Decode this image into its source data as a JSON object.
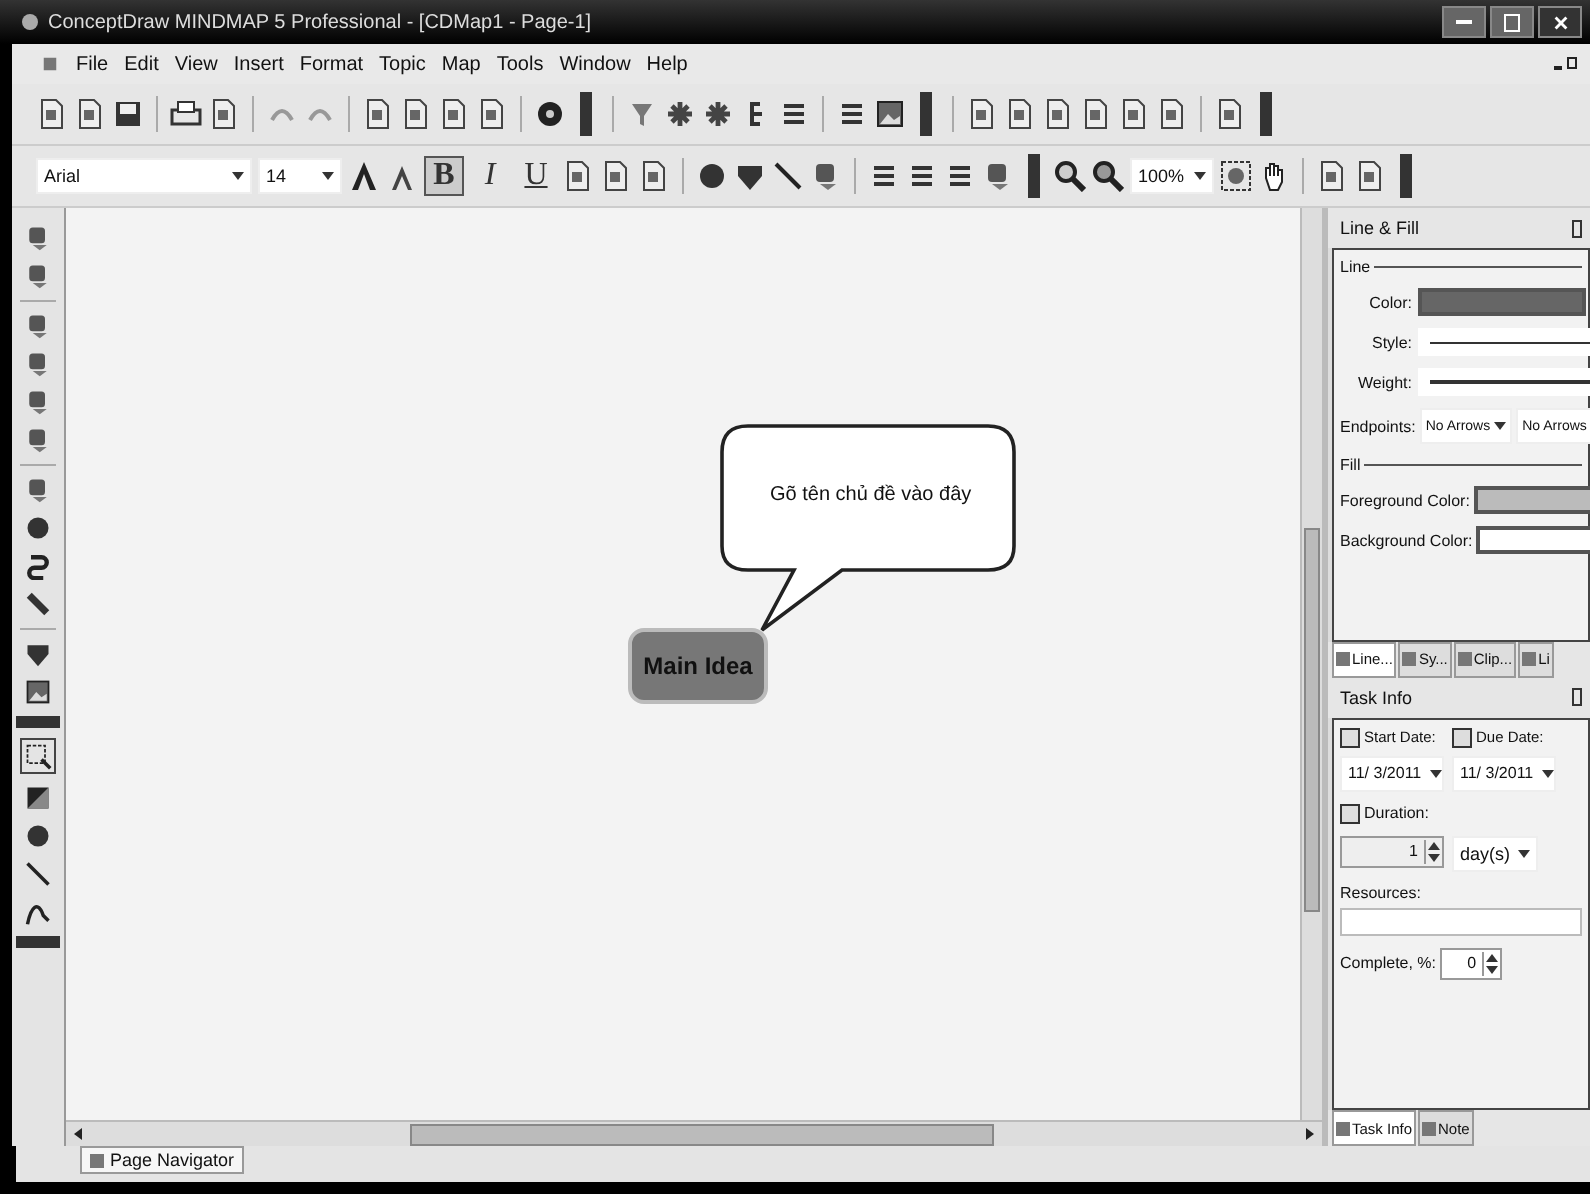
{
  "window": {
    "title": "ConceptDraw MINDMAP 5 Professional - [CDMap1 - Page-1]"
  },
  "menu": [
    "File",
    "Edit",
    "View",
    "Insert",
    "Format",
    "Topic",
    "Map",
    "Tools",
    "Window",
    "Help"
  ],
  "format_toolbar": {
    "font": "Arial",
    "size": "14",
    "zoom": "100%",
    "styles": [
      {
        "label": "B",
        "kind": "bold",
        "selected": true
      },
      {
        "label": "I",
        "kind": "italic",
        "selected": false
      },
      {
        "label": "U",
        "kind": "underline",
        "selected": false
      }
    ]
  },
  "canvas": {
    "callout": "Gõ tên chủ đề vào đây",
    "main_topic": "Main Idea"
  },
  "line_fill_panel": {
    "title": "Line & Fill",
    "line_section": "Line",
    "color_label": "Color:",
    "style_label": "Style:",
    "weight_label": "Weight:",
    "endpoints_label": "Endpoints:",
    "endpoint_start": "No Arrows",
    "endpoint_end": "No Arrows",
    "fill_section": "Fill",
    "foreground_label": "Foreground Color:",
    "background_label": "Background Color:",
    "tabs": [
      {
        "label": "Line...",
        "selected": true
      },
      {
        "label": "Sy...",
        "selected": false
      },
      {
        "label": "Clip...",
        "selected": false
      },
      {
        "label": "Li",
        "selected": false
      }
    ]
  },
  "task_info_panel": {
    "title": "Task Info",
    "start_date": {
      "label": "Start Date:",
      "checked": false,
      "value": "11/ 3/2011"
    },
    "due_date": {
      "label": "Due Date:",
      "checked": false,
      "value": "11/ 3/2011"
    },
    "duration": {
      "label": "Duration:",
      "checked": false,
      "value": "1",
      "unit": "day(s)"
    },
    "resources_label": "Resources:",
    "complete_label": "Complete, %:",
    "complete_value": "0",
    "tabs": [
      {
        "label": "Task Info",
        "selected": true
      },
      {
        "label": "Note",
        "selected": false
      }
    ]
  },
  "bottom_tabs": [
    {
      "label": "Page Navigator",
      "selected": true
    }
  ]
}
